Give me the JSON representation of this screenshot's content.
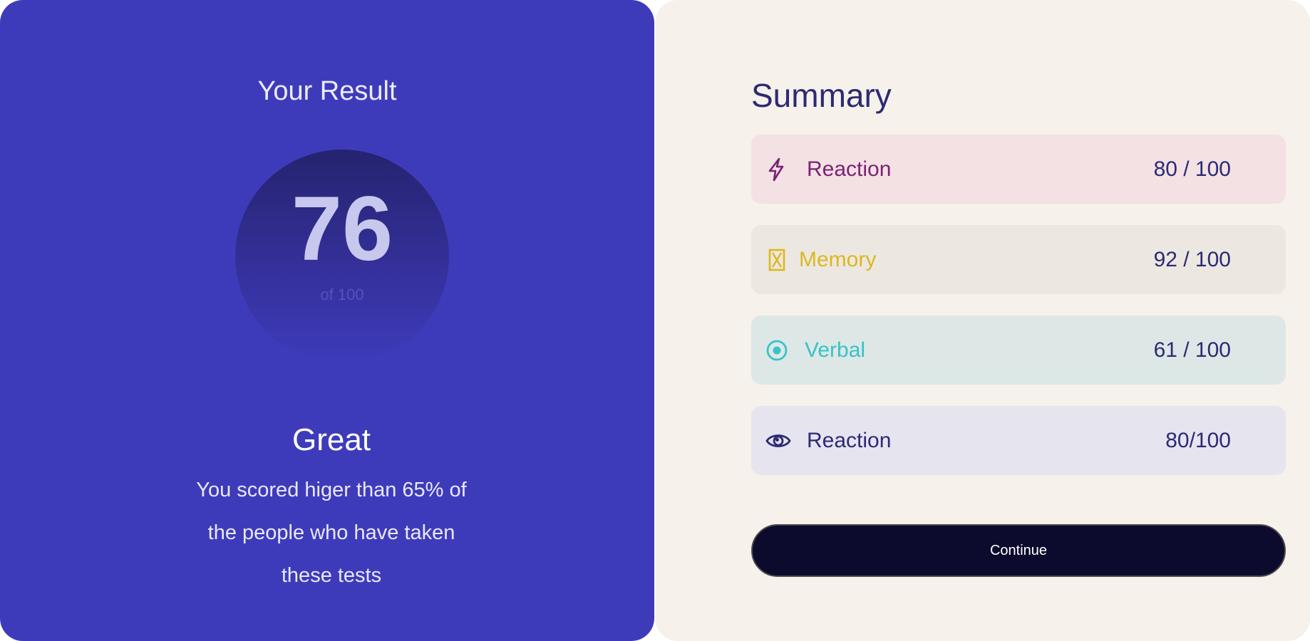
{
  "result": {
    "title": "Your Result",
    "score": "76",
    "of_total": "of 100",
    "rating": "Great",
    "description": "You scored higer than 65% of the people who have taken these tests"
  },
  "summary": {
    "title": "Summary",
    "items": [
      {
        "label": "Reaction",
        "score": "80 / 100",
        "icon": "lightning-icon",
        "bg": "#f4e1e3",
        "color": "#7a2275"
      },
      {
        "label": "Memory",
        "score": "92 / 100",
        "icon": "hourglass-icon",
        "bg": "#ece8e1",
        "color": "#dcb71f"
      },
      {
        "label": "Verbal",
        "score": "61 / 100",
        "icon": "target-icon",
        "bg": "#dde8e6",
        "color": "#39c2c8"
      },
      {
        "label": "Reaction",
        "score": "80/100",
        "icon": "eye-icon",
        "bg": "#e6e4ef",
        "color": "#2c2a74"
      }
    ],
    "continue_label": "Continue"
  },
  "colors": {
    "primary": "#3e3bbb",
    "background": "#f6f1ea",
    "button": "#0c0b2e"
  }
}
